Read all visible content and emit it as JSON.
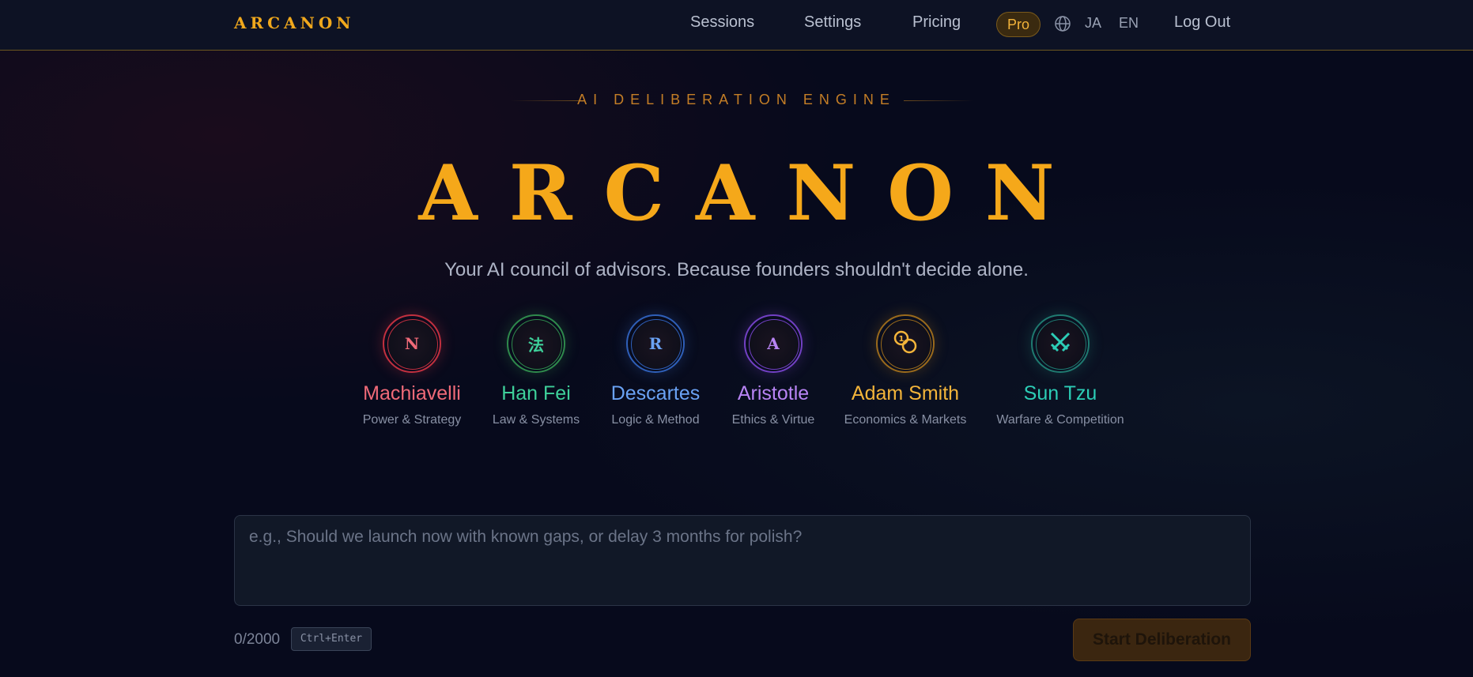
{
  "nav": {
    "logo": "ARCANON",
    "links": [
      "Sessions",
      "Settings",
      "Pricing"
    ],
    "pro_badge": "Pro",
    "globe_icon": "globe-icon",
    "lang_ja": "JA",
    "lang_en": "EN",
    "logout": "Log Out"
  },
  "hero": {
    "eyebrow": "AI DELIBERATION ENGINE",
    "title": "ARCANON",
    "tagline": "Your AI council of advisors. Because founders shouldn't decide alone."
  },
  "advisors": [
    {
      "name": "Machiavelli",
      "role": "Power & Strategy",
      "glyph": "N",
      "color": "#f06a78",
      "ring": "#c2303f",
      "icon": "machiavelli-emblem-icon"
    },
    {
      "name": "Han Fei",
      "role": "Law & Systems",
      "glyph": "法",
      "color": "#3ed09a",
      "ring": "#2f8a4c",
      "icon": "han-fei-emblem-icon"
    },
    {
      "name": "Descartes",
      "role": "Logic & Method",
      "glyph": "R",
      "color": "#6aa2f4",
      "ring": "#2f5fb8",
      "icon": "descartes-emblem-icon"
    },
    {
      "name": "Aristotle",
      "role": "Ethics & Virtue",
      "glyph": "A",
      "color": "#b884f4",
      "ring": "#7240c4",
      "icon": "aristotle-emblem-icon"
    },
    {
      "name": "Adam Smith",
      "role": "Economics & Markets",
      "glyph": "coins",
      "color": "#f3b43a",
      "ring": "#9a6a1c",
      "icon": "coins-icon"
    },
    {
      "name": "Sun Tzu",
      "role": "Warfare & Competition",
      "glyph": "swords",
      "color": "#2ccdb6",
      "ring": "#1f7a70",
      "icon": "crossed-swords-icon"
    }
  ],
  "composer": {
    "placeholder": "e.g., Should we launch now with known gaps, or delay 3 months for polish?",
    "counter": "0/2000",
    "shortcut": "Ctrl+Enter",
    "submit": "Start Deliberation"
  }
}
